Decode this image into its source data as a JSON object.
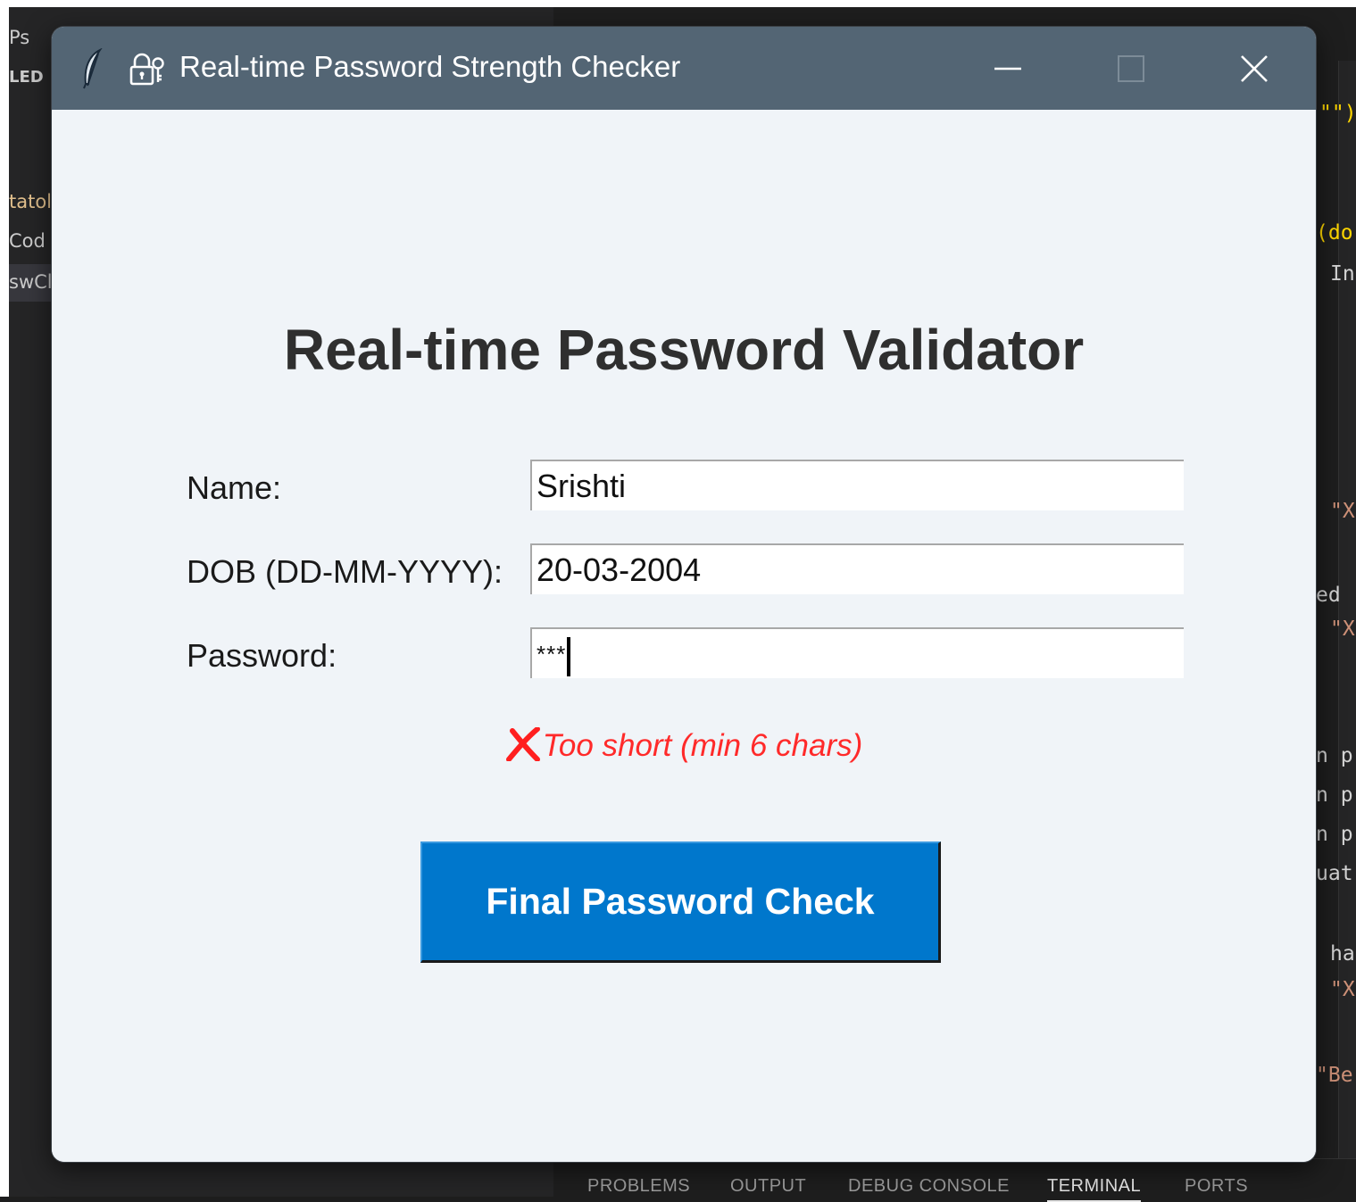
{
  "background": {
    "sidebar_items": [
      "Ps",
      "LED",
      "tatol",
      "Cod",
      "swCl"
    ],
    "code_fragments": [
      "\"\")",
      "(do",
      "In",
      "\"X",
      "ed",
      "\"X",
      "n p",
      "n p",
      "n p",
      "uat",
      "ha",
      "\"X",
      "\"Be"
    ],
    "panel_tabs": [
      "PROBLEMS",
      "OUTPUT",
      "DEBUG CONSOLE",
      "TERMINAL",
      "PORTS"
    ],
    "active_panel_tab": "TERMINAL"
  },
  "window": {
    "title": "Real-time Password Strength Checker",
    "icons": [
      "feather-icon",
      "lock-icon",
      "minimize-icon",
      "maximize-icon",
      "close-icon"
    ]
  },
  "form": {
    "heading": "Real-time Password Validator",
    "name_label": "Name:",
    "name_value": "Srishti",
    "dob_label": "DOB (DD-MM-YYYY):",
    "dob_value": "20-03-2004",
    "password_label": "Password:",
    "password_value": "***",
    "status_message": "Too short (min 6 chars)",
    "status_color": "#ff2a2a",
    "button_label": "Final Password Check",
    "button_color": "#0077cc"
  }
}
